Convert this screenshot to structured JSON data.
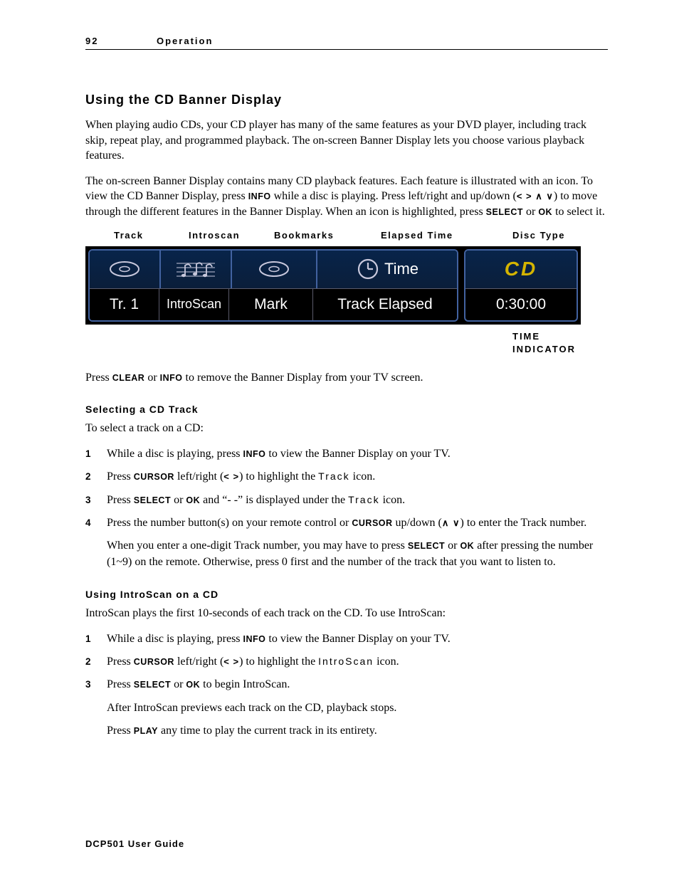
{
  "header": {
    "page_number": "92",
    "section": "Operation"
  },
  "title": "Using the CD Banner Display",
  "para1": "When playing audio CDs, your CD player has many of the same features as your DVD player, including track skip, repeat play, and programmed playback. The on-screen Banner Display lets you choose various playback features.",
  "para2_a": "The on-screen Banner Display contains many CD playback features. Each feature is illustrated with an icon. To view the CD Banner Display, press ",
  "para2_info": "INFO",
  "para2_b": " while a disc is playing. Press left/right and up/down (",
  "para2_arrows": "< > ∧ ∨",
  "para2_c": ") to move through the different features in the Banner Display. When an icon is highlighted, press ",
  "para2_select": "SELECT",
  "para2_or1": " or ",
  "para2_ok": "OK",
  "para2_d": " to select it.",
  "labels": {
    "track": "Track",
    "introscan": "Introscan",
    "bookmarks": "Bookmarks",
    "elapsed": "Elapsed Time",
    "disctype": "Disc Type"
  },
  "banner": {
    "time_icon_label": "Time",
    "track": "Tr.  1",
    "introscan": "IntroScan",
    "bookmarks": "Mark",
    "elapsed": "Track Elapsed",
    "cd": "CD",
    "time_value": "0:30:00"
  },
  "time_indicator_line1": "TIME",
  "time_indicator_line2": "INDICATOR",
  "para3_a": "Press ",
  "para3_clear": "CLEAR",
  "para3_b": " or ",
  "para3_info": "INFO",
  "para3_c": " to remove the Banner Display from your TV screen.",
  "sel_head": "Selecting a CD Track",
  "sel_intro": "To select a track on a CD:",
  "sel_steps": {
    "s1a": "While a disc is playing, press ",
    "s1_info": "INFO",
    "s1b": " to view the Banner Display on your TV.",
    "s2a": "Press ",
    "s2_cursor": "CURSOR",
    "s2b": " left/right (",
    "s2_arrows": "< >",
    "s2c": ") to highlight the ",
    "s2_track": "Track",
    "s2d": " icon.",
    "s3a": "Press ",
    "s3_select": "SELECT",
    "s3b": " or ",
    "s3_ok": "OK",
    "s3c": " and “-  -” is displayed under the ",
    "s3_track": "Track",
    "s3d": " icon.",
    "s4a": "Press the number button(s) on your remote control or ",
    "s4_cursor": "CURSOR",
    "s4b": " up/down (",
    "s4_arrows": "∧ ∨",
    "s4c": ") to enter the Track number.",
    "s4_p2a": "When you enter a one-digit Track number, you may have to press ",
    "s4_p2_select": "SELECT",
    "s4_p2b": " or ",
    "s4_p2_ok": "OK",
    "s4_p2c": " after pressing the number (1~9) on the remote. Otherwise, press 0 first and the number of the track that you want to listen to."
  },
  "is_head": "Using IntroScan on a CD",
  "is_intro": "IntroScan plays the first 10-seconds of each track on the CD. To use IntroScan:",
  "is_steps": {
    "s1a": "While a disc is playing, press ",
    "s1_info": "INFO",
    "s1b": " to view the Banner Display on your TV.",
    "s2a": "Press ",
    "s2_cursor": "CURSOR",
    "s2b": " left/right (",
    "s2_arrows": "< >",
    "s2c": ") to highlight the ",
    "s2_is": "IntroScan",
    "s2d": " icon.",
    "s3a": "Press ",
    "s3_select": "SELECT",
    "s3b": " or ",
    "s3_ok": "OK",
    "s3c": " to begin IntroScan.",
    "s3_p2": "After IntroScan previews each track on the CD, playback stops.",
    "s3_p3a": "Press ",
    "s3_p3_play": "PLAY",
    "s3_p3b": " any time to play the current track in its entirety."
  },
  "footer": "DCP501 User Guide"
}
